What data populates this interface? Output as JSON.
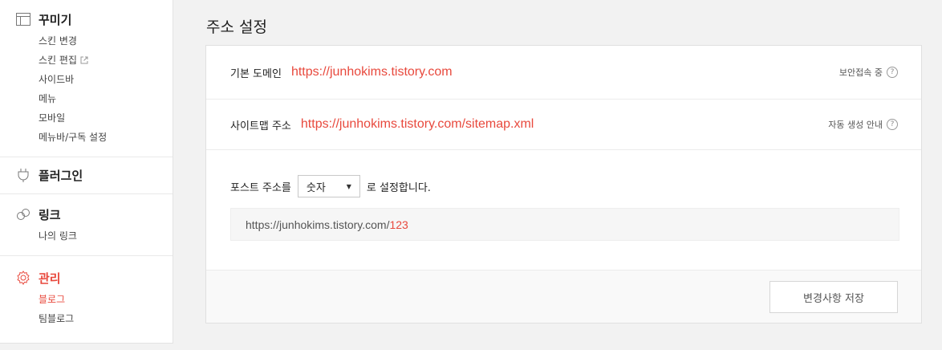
{
  "sidebar": {
    "groups": [
      {
        "title": "꾸미기",
        "icon": "layout-icon",
        "items": [
          {
            "label": "스킨 변경"
          },
          {
            "label": "스킨 편집",
            "external": true
          },
          {
            "label": "사이드바"
          },
          {
            "label": "메뉴"
          },
          {
            "label": "모바일"
          },
          {
            "label": "메뉴바/구독 설정"
          }
        ]
      },
      {
        "title": "플러그인",
        "icon": "plug-icon",
        "items": []
      },
      {
        "title": "링크",
        "icon": "link-icon",
        "items": [
          {
            "label": "나의 링크"
          }
        ]
      },
      {
        "title": "관리",
        "icon": "gear-icon",
        "active": true,
        "items": [
          {
            "label": "블로그",
            "active": true
          },
          {
            "label": "팀블로그"
          }
        ]
      }
    ]
  },
  "main": {
    "title": "주소 설정",
    "default_domain": {
      "label": "기본 도메인",
      "url": "https://junhokims.tistory.com",
      "status": "보안접속 중"
    },
    "sitemap": {
      "label": "사이트맵 주소",
      "url": "https://junhokims.tistory.com/sitemap.xml",
      "status": "자동 생성 안내"
    },
    "post_address": {
      "prefix": "포스트 주소를",
      "selected": "숫자",
      "suffix": "로 설정합니다.",
      "preview_base": "https://junhokims.tistory.com/",
      "preview_num": "123"
    },
    "save_label": "변경사항 저장"
  },
  "colors": {
    "accent": "#e8493d",
    "background": "#f2f2f2"
  }
}
